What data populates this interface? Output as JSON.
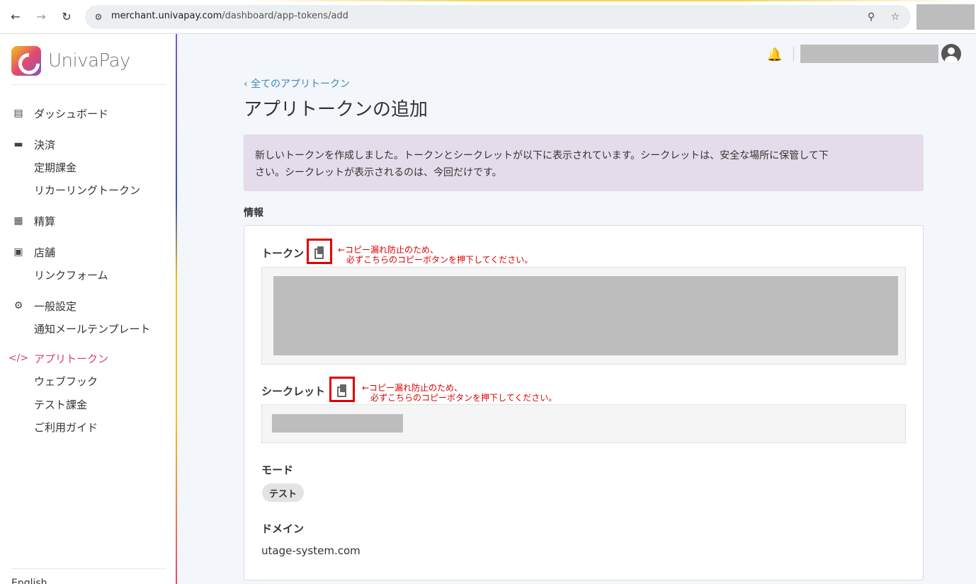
{
  "browser": {
    "url_host": "merchant.univapay.com",
    "url_path": "/dashboard/app-tokens/add"
  },
  "brand": {
    "name": "UnivaPay"
  },
  "sidebar": {
    "items": [
      {
        "label": "ダッシュボード",
        "icon": "bar-chart-icon"
      },
      {
        "label": "決済",
        "icon": "credit-card-icon",
        "sub": [
          "定期課金",
          "リカーリングトークン"
        ]
      },
      {
        "label": "精算",
        "icon": "receipt-icon"
      },
      {
        "label": "店舗",
        "icon": "store-icon",
        "sub": [
          "リンクフォーム"
        ]
      },
      {
        "label": "一般設定",
        "icon": "gear-icon",
        "sub": [
          "通知メールテンプレート"
        ]
      },
      {
        "label": "アプリトークン",
        "icon": "code-icon",
        "sub": [
          "ウェブフック",
          "テスト課金",
          "ご利用ガイド"
        ]
      }
    ],
    "language": "English"
  },
  "main": {
    "back_link": "‹ 全てのアプリトークン",
    "title": "アプリトークンの追加",
    "notice_line1": "新しいトークンを作成しました。トークンとシークレットが以下に表示されています。シークレットは、安全な場所に保管して下",
    "notice_line2": "さい。シークレットが表示されるのは、今回だけです。",
    "section": "情報",
    "token_label": "トークン",
    "secret_label": "シークレット",
    "annotation_line1": "←コピー漏れ防止のため、",
    "annotation_line2": "必ずこちらのコピーボタンを押下してください。",
    "mode_label": "モード",
    "mode_value": "テスト",
    "domain_label": "ドメイン",
    "domain_value": "utage-system.com"
  },
  "colors": {
    "accent": "#d8417a",
    "link": "#3d88b8",
    "notice_bg": "#e4dcea",
    "annotation": "#e00000"
  }
}
